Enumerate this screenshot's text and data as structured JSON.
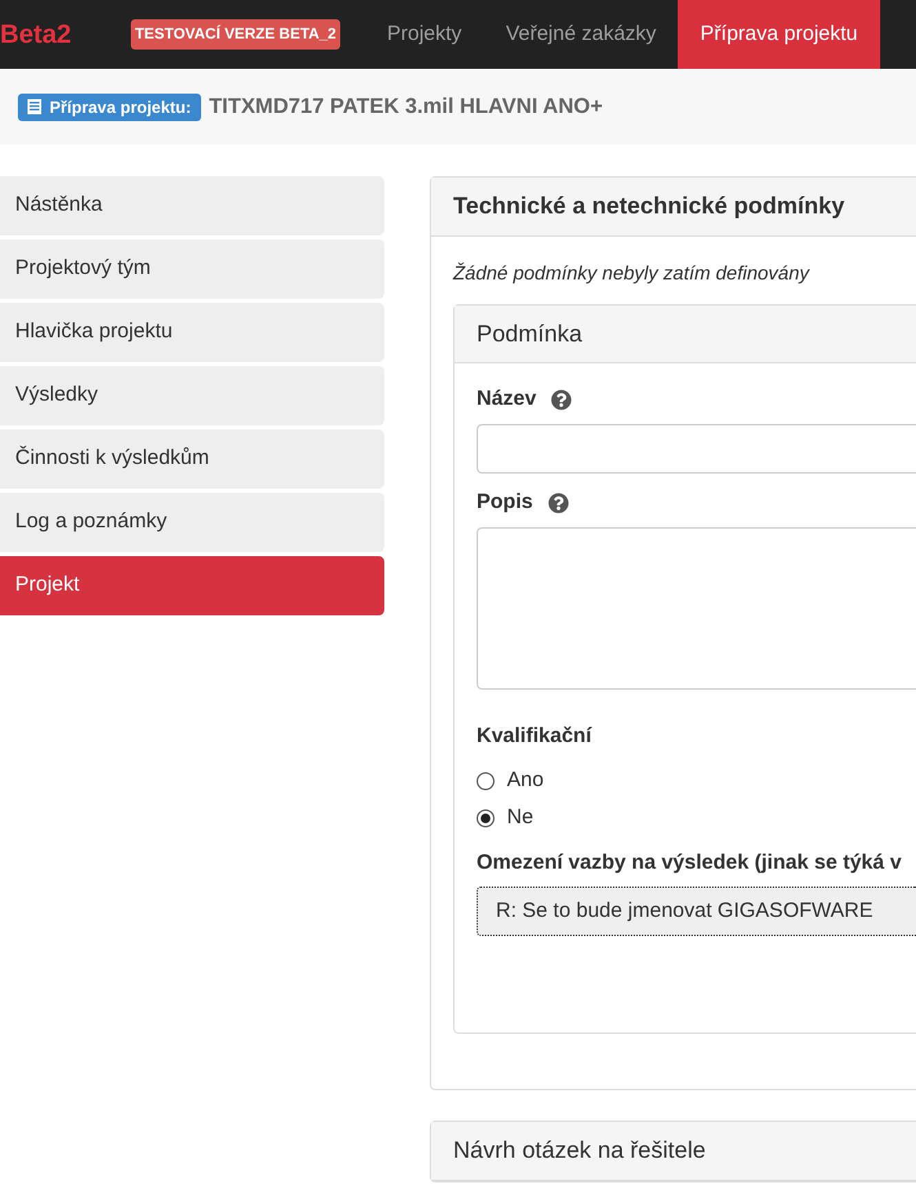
{
  "navbar": {
    "logo": "Beta2",
    "badge": "TESTOVACÍ VERZE BETA_2",
    "items": [
      {
        "label": "Projekty",
        "selected": false
      },
      {
        "label": "Veřejné zakázky",
        "selected": false
      },
      {
        "label": "Příprava projektu",
        "selected": true
      }
    ]
  },
  "breadcrumb": {
    "label": "Příprava projektu:",
    "title": "TITXMD717 PATEK 3.mil HLAVNI ANO+"
  },
  "sidebar": {
    "items": [
      {
        "label": "Nástěnka",
        "selected": false
      },
      {
        "label": "Projektový tým",
        "selected": false
      },
      {
        "label": "Hlavička projektu",
        "selected": false
      },
      {
        "label": "Výsledky",
        "selected": false
      },
      {
        "label": "Činnosti k výsledkům",
        "selected": false
      },
      {
        "label": "Log a poznámky",
        "selected": false
      },
      {
        "label": "Projekt",
        "selected": true
      }
    ]
  },
  "panels": [
    {
      "title": "Technické a netechnické podmínky",
      "note": "Žádné podmínky nebyly zatím definovány",
      "form": {
        "title": "Podmínka",
        "fields": [
          {
            "kind": "text",
            "label": "Název",
            "help": true
          },
          {
            "kind": "textarea",
            "label": "Popis",
            "help": true
          },
          {
            "kind": "radio",
            "label": "Kvalifikační",
            "options": [
              {
                "label": "Ano",
                "selected": false
              },
              {
                "label": "Ne",
                "selected": true
              }
            ]
          },
          {
            "kind": "select",
            "label": "Omezení vazby na výsledek (jinak se týká v",
            "value": "R: Se to bude jmenovat GIGASOFWARE",
            "focused": true
          }
        ]
      }
    },
    {
      "title": "Návrh otázek na řešitele"
    }
  ]
}
